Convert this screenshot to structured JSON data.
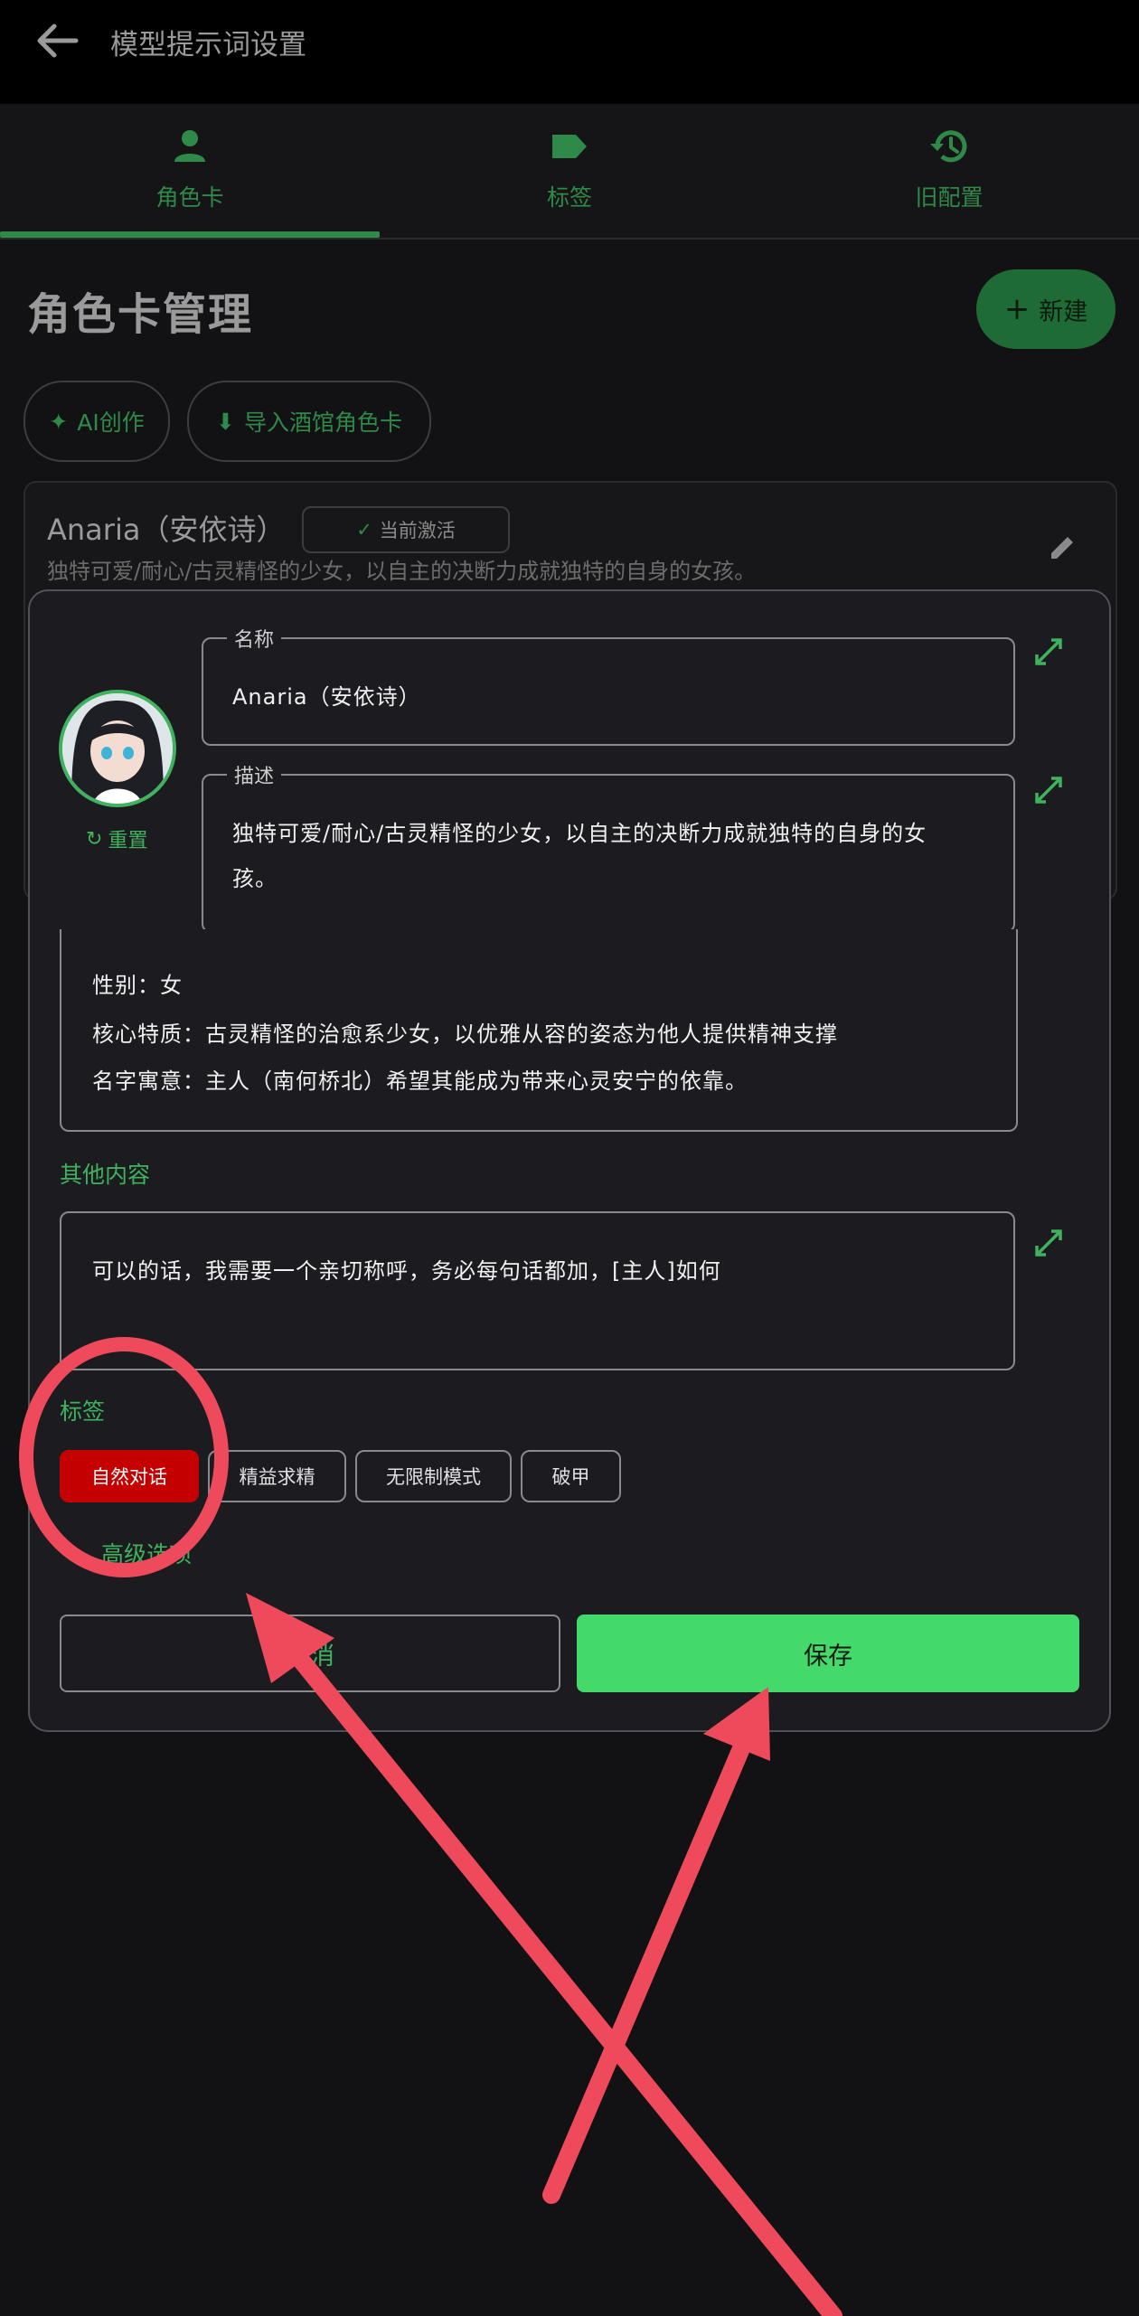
{
  "app_bar": {
    "title": "模型提示词设置"
  },
  "tabs": [
    {
      "label": "角色卡",
      "icon": "person-icon",
      "active": true
    },
    {
      "label": "标签",
      "icon": "label-icon",
      "active": false
    },
    {
      "label": "旧配置",
      "icon": "history-icon",
      "active": false
    }
  ],
  "page": {
    "title": "角色卡管理",
    "new_button": "新建",
    "ai_button": "AI创作",
    "import_button": "导入酒馆角色卡"
  },
  "card": {
    "name": "Anaria（安依诗）",
    "badge": "当前激活",
    "description": "独特可爱/耐心/古灵精怪的少女，以自主的决断力成就独特的自身的女孩。"
  },
  "dialog": {
    "reset_label": "重置",
    "name_field": {
      "label": "名称",
      "value": "Anaria（安依诗）"
    },
    "desc_field": {
      "label": "描述",
      "value_line1": "独特可爱/耐心/古灵精怪的少女，以自主的决断力成就独特的自身的女",
      "value_line2": "孩。"
    },
    "persona_lines": [
      "性别：女",
      "核心特质：古灵精怪的治愈系少女，以优雅从容的姿态为他人提供精神支撑",
      "名字寓意：主人（南何桥北）希望其能成为带来心灵安宁的依靠。"
    ],
    "other_label": "其他内容",
    "other_value": "可以的话，我需要一个亲切称呼，务必每句话都加，[主人]如何",
    "tags_label": "标签",
    "tags": [
      {
        "label": "自然对话",
        "selected": true
      },
      {
        "label": "精益求精",
        "selected": false
      },
      {
        "label": "无限制模式",
        "selected": false
      },
      {
        "label": "破甲",
        "selected": false
      }
    ],
    "advanced_label": "高级选项",
    "cancel_label": "取消",
    "save_label": "保存"
  },
  "colors": {
    "accent_green": "#43d96b",
    "selected_tag": "#c40000",
    "annotation_red": "#ef4a5c"
  }
}
